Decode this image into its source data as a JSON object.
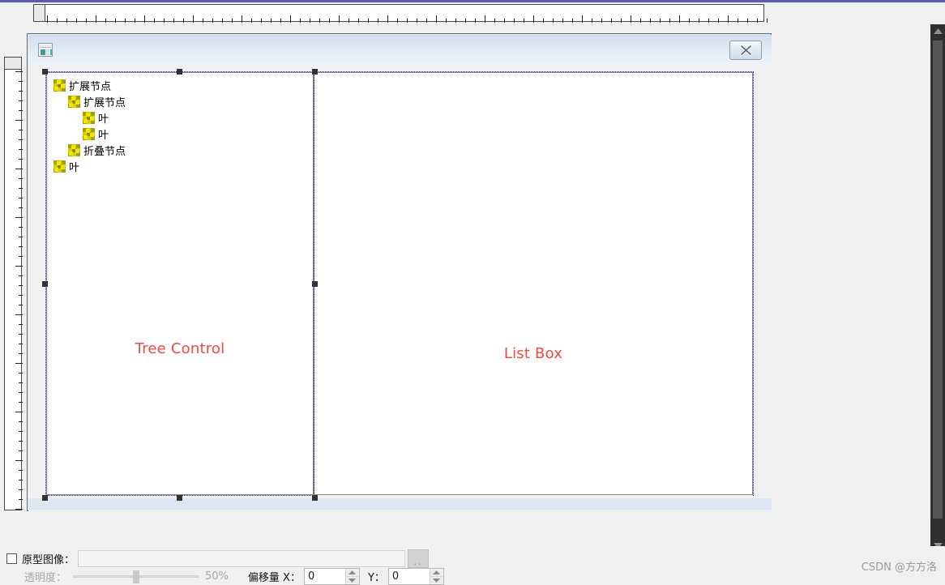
{
  "window": {
    "dialog_icon": "window-icon",
    "close_icon": "close-x-icon"
  },
  "tree_control": {
    "caption": "Tree Control",
    "caption_color": "#f4493f",
    "nodes": [
      {
        "label": "扩展节点",
        "indent": 0,
        "icon": "tree-node-icon"
      },
      {
        "label": "扩展节点",
        "indent": 1,
        "icon": "tree-node-icon"
      },
      {
        "label": "叶",
        "indent": 2,
        "icon": "tree-leaf-icon"
      },
      {
        "label": "叶",
        "indent": 2,
        "icon": "tree-leaf-icon"
      },
      {
        "label": "折叠节点",
        "indent": 1,
        "icon": "tree-node-icon"
      },
      {
        "label": "叶",
        "indent": 0,
        "icon": "tree-leaf-icon"
      }
    ]
  },
  "list_box": {
    "caption": "List Box",
    "caption_color": "#f4493f",
    "items": []
  },
  "bottom_panel": {
    "prototype_image": {
      "checkbox_checked": false,
      "label": "原型图像：",
      "path_value": "",
      "browse_label": ".."
    },
    "opacity": {
      "label": "透明度：",
      "value": 50,
      "value_text": "50%"
    },
    "offset": {
      "label": "偏移量 X：",
      "x_value": "0",
      "y_label": "Y：",
      "y_value": "0"
    }
  },
  "watermark": "CSDN @方方洛",
  "scrollbar": {
    "up_icon": "scroll-up-arrow-icon",
    "down_icon": "scroll-down-arrow-icon"
  }
}
